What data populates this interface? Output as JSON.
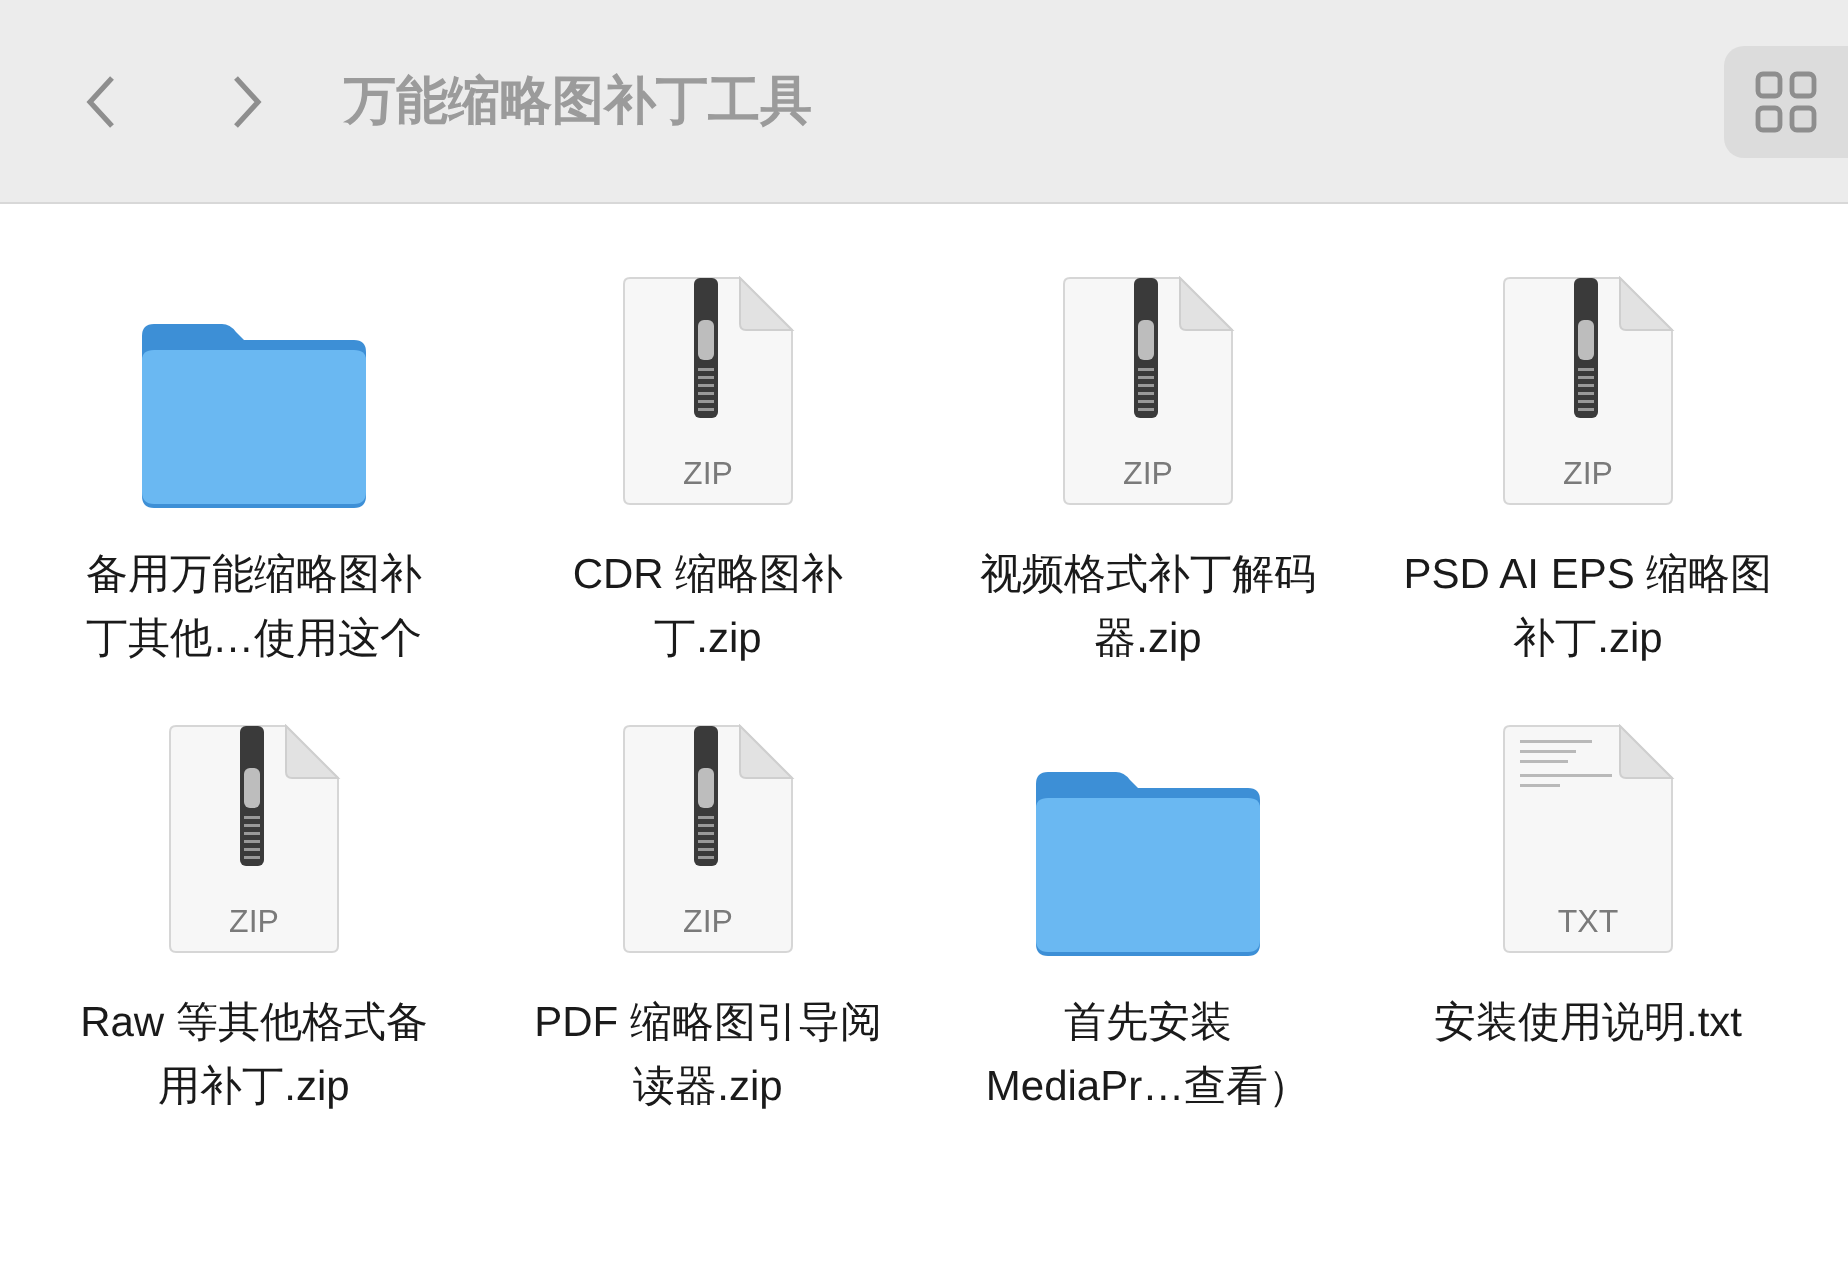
{
  "toolbar": {
    "title": "万能缩略图补丁工具"
  },
  "items": [
    {
      "kind": "folder",
      "name": [
        "备用万能缩略图补",
        "丁其他…使用这个"
      ]
    },
    {
      "kind": "zip",
      "badge": "ZIP",
      "name": [
        "CDR 缩略图补",
        "丁.zip"
      ]
    },
    {
      "kind": "zip",
      "badge": "ZIP",
      "name": [
        "视频格式补丁解码",
        "器.zip"
      ]
    },
    {
      "kind": "zip",
      "badge": "ZIP",
      "name": [
        "PSD AI EPS 缩略图",
        "补丁.zip"
      ]
    },
    {
      "kind": "zip",
      "badge": "ZIP",
      "name": [
        "Raw 等其他格式备",
        "用补丁.zip"
      ]
    },
    {
      "kind": "zip",
      "badge": "ZIP",
      "name": [
        "PDF 缩略图引导阅",
        "读器.zip"
      ]
    },
    {
      "kind": "folder",
      "name": [
        "首先安装",
        "MediaPr…查看）"
      ]
    },
    {
      "kind": "txt",
      "badge": "TXT",
      "name": [
        "安装使用说明.txt"
      ]
    }
  ]
}
